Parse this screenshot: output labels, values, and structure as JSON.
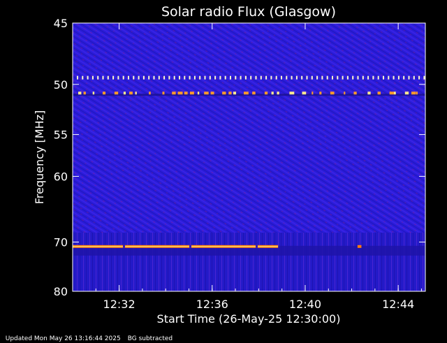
{
  "chart_data": {
    "type": "heatmap",
    "title": "Solar radio Flux (Glasgow)",
    "xlabel": "Start Time (26-May-25 12:30:00)",
    "ylabel": "Frequency [MHz]",
    "x_start": "12:30:00",
    "x_end": "12:45:10",
    "x_ticks": [
      "12:32",
      "12:36",
      "12:40",
      "12:44"
    ],
    "y_ticks": [
      45,
      50,
      55,
      60,
      70,
      80
    ],
    "y_range": [
      45,
      80
    ],
    "y_scale": "reciprocal",
    "background_color": "#2a1cd8",
    "features": [
      {
        "kind": "interference-band",
        "frequency_mhz": 49.4,
        "time_from": "12:30:00",
        "time_to": "12:45:10",
        "style": "dashed-bright"
      },
      {
        "kind": "interference-band",
        "frequency_mhz": 50.8,
        "time_from": "12:30:00",
        "time_to": "12:45:10",
        "style": "intermittent-bright"
      },
      {
        "kind": "interference-band",
        "frequency_mhz": 70.8,
        "time_from": "12:30:00",
        "time_to": "12:38:50",
        "style": "continuous-orange"
      },
      {
        "kind": "interference-spot",
        "frequency_mhz": 70.8,
        "time_from": "12:42:15",
        "time_to": "12:42:25",
        "style": "orange"
      }
    ]
  },
  "footer": {
    "updated": "Updated Mon May 26 13:16:44 2025",
    "note": "BG subtracted"
  }
}
